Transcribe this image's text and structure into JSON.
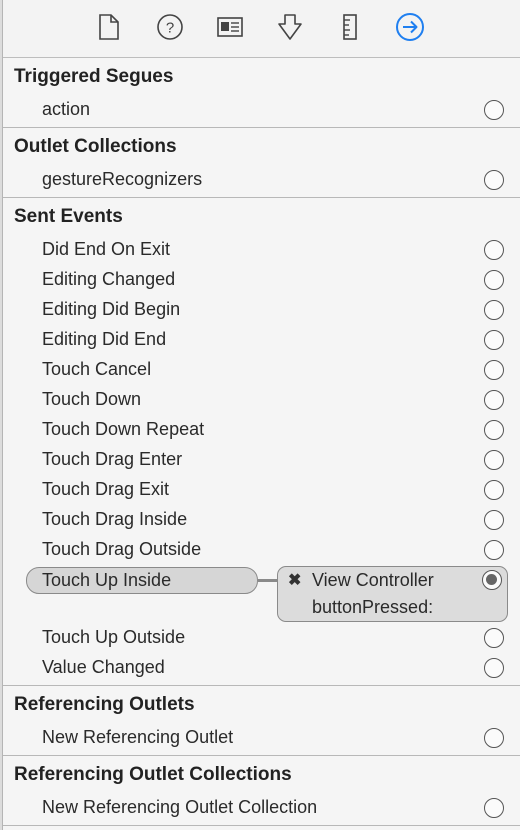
{
  "toolbar": {
    "icons": [
      "file-inspector-icon",
      "quick-help-icon",
      "identity-inspector-icon",
      "attributes-inspector-icon",
      "size-inspector-icon",
      "connections-inspector-icon"
    ],
    "accent_color": "#1f7ff0"
  },
  "sections": {
    "triggered_segues": {
      "title": "Triggered Segues",
      "items": [
        "action"
      ]
    },
    "outlet_collections": {
      "title": "Outlet Collections",
      "items": [
        "gestureRecognizers"
      ]
    },
    "sent_events": {
      "title": "Sent Events",
      "items": [
        "Did End On Exit",
        "Editing Changed",
        "Editing Did Begin",
        "Editing Did End",
        "Touch Cancel",
        "Touch Down",
        "Touch Down Repeat",
        "Touch Drag Enter",
        "Touch Drag Exit",
        "Touch Drag Inside",
        "Touch Drag Outside",
        "Touch Up Inside",
        "Touch Up Outside",
        "Value Changed"
      ],
      "connection": {
        "remove_glyph": "✖",
        "target": "View Controller",
        "method": "buttonPressed:"
      }
    },
    "referencing_outlets": {
      "title": "Referencing Outlets",
      "items": [
        "New Referencing Outlet"
      ]
    },
    "referencing_outlet_collections": {
      "title": "Referencing Outlet Collections",
      "items": [
        "New Referencing Outlet Collection"
      ]
    }
  }
}
